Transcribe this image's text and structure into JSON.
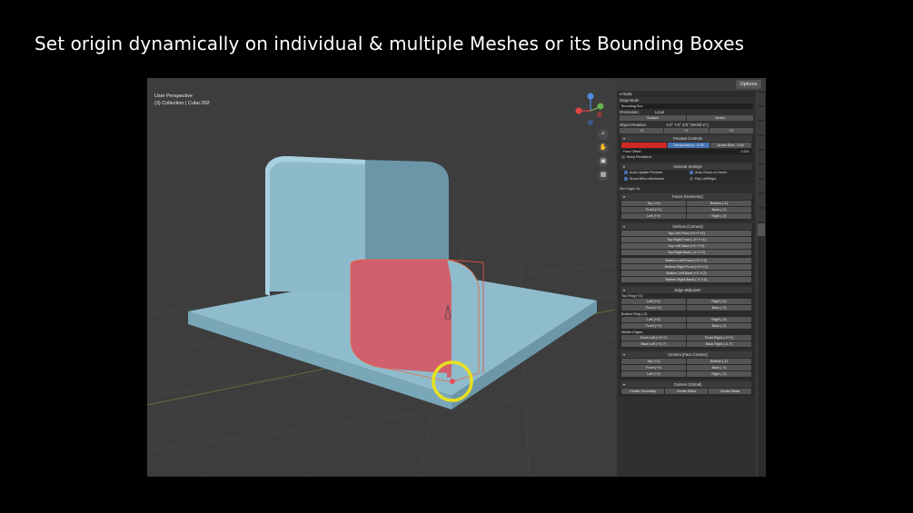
{
  "headline": "Set origin dynamically on individual & multiple Meshes or its Bounding Boxes",
  "viewport": {
    "perspective_label": "User Perspective",
    "collection_label": "(3) Collection | Cube.002",
    "options_label": "Options"
  },
  "panel": {
    "header": "Radix",
    "snap_mode_label": "Snap Mode",
    "snap_mode_value": "Bounding Box",
    "orientation_label": "Orientation:",
    "orientation_value": "Local",
    "surface_label": "Surface",
    "vertex_label": "Vertex",
    "object_rotation_label": "Object Rotation:",
    "object_rotation_value": "X:0° Y:0° Z:0° (World Z+)",
    "rot_buttons": [
      "+Z",
      "+Y",
      "+X"
    ],
    "preview_controls": {
      "title": "Preview Controls",
      "transparency": "Transparency : 0.35",
      "arrow_size": "Arrow Size : 0.45",
      "face_offset_label": "Face Offset",
      "face_offset_value": "0.001",
      "keep_persistent": "Keep Persistent"
    },
    "general_settings": {
      "title": "General Settings",
      "auto_update": "Auto-Update Preview",
      "auto_show": "Auto-Show on Hover",
      "show_bbox": "Show BBox Wireframe",
      "flip": "Flip Left/Right"
    },
    "set_origin_to": "Set Origin To:",
    "faces": {
      "title": "Faces (Geometry)",
      "rows": [
        [
          "Top (+Z)",
          "Bottom (-Z)"
        ],
        [
          "Front (+Y)",
          "Back (-Y)"
        ],
        [
          "Left (+X)",
          "Right (-X)"
        ]
      ]
    },
    "vertices": {
      "title": "Vertices (Corners)",
      "top": [
        "Top Left Front (+X+Y+Z)",
        "Top Right Front (-X+Y+Z)",
        "Top Left Back (+X-Y+Z)",
        "Top Right Back (-X-Y+Z)"
      ],
      "bottom": [
        "Bottom Left Front (+X+Y-Z)",
        "Bottom Right Front (-X+Y-Z)",
        "Bottom Left Back (+X-Y-Z)",
        "Bottom Right Back (-X-Y-Z)"
      ]
    },
    "edges": {
      "title": "Edge Midpoints",
      "top_ring": "Top Ring (+Z):",
      "top_rows": [
        [
          "Left (+X)",
          "Right (-X)"
        ],
        [
          "Front (+Y)",
          "Back (-Y)"
        ]
      ],
      "bottom_ring": "Bottom Ring (-Z):",
      "bottom_rows": [
        [
          "Left (+X)",
          "Right (-X)"
        ],
        [
          "Front (+Y)",
          "Back (-Y)"
        ]
      ],
      "middle": "Middle Edges:",
      "middle_rows": [
        [
          "Front Left (+X+Y)",
          "Front Right (-X+Y)"
        ],
        [
          "Back Left (+X-Y)",
          "Back Right (-X-Y)"
        ]
      ]
    },
    "centers": {
      "title": "Centers (Face Centers)",
      "rows": [
        [
          "Top (+Z)",
          "Bottom (-Z)"
        ],
        [
          "Front (+Y)",
          "Back (-Y)"
        ],
        [
          "Left (+X)",
          "Right (-X)"
        ]
      ]
    },
    "global": {
      "title": "Centers (Global)",
      "buttons": [
        "Center Geometry",
        "Center BBox",
        "Center Mass"
      ]
    }
  },
  "colors": {
    "accent": "#4772b3",
    "highlight_ring": "#e8e020",
    "selected_mesh": "#d0606e",
    "mesh": "#8fbccc"
  }
}
